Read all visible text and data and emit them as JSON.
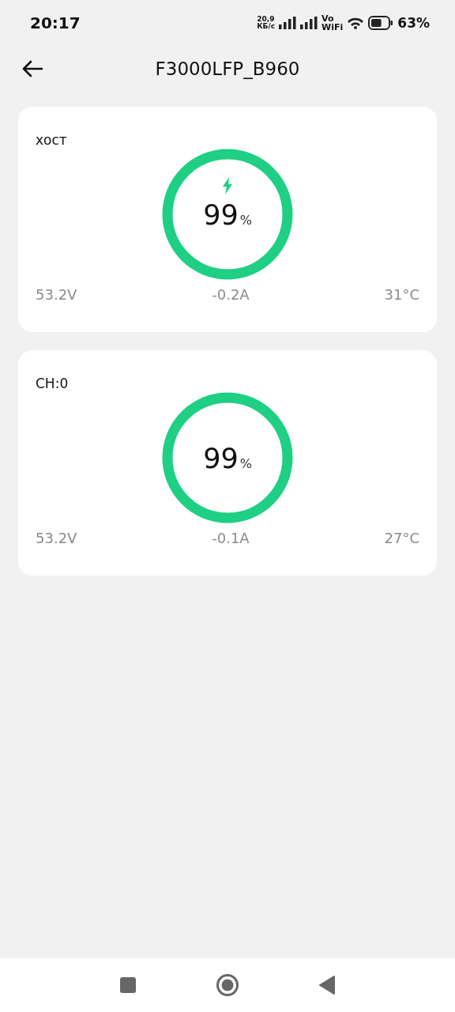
{
  "status_bar": {
    "time": "20:17",
    "net_speed": "20,9",
    "net_unit": "КБ/с",
    "volte": "Vo",
    "wifi_label": "WiFi",
    "battery": "63%"
  },
  "header": {
    "title": "F3000LFP_B960"
  },
  "packs": [
    {
      "name": "хост",
      "charging": true,
      "level": 0.99,
      "percent": "99",
      "unit": "%",
      "voltage": "53.2V",
      "current": "-0.2A",
      "temperature": "31°C"
    },
    {
      "name": "CH:0",
      "charging": false,
      "level": 0.99,
      "percent": "99",
      "unit": "%",
      "voltage": "53.2V",
      "current": "-0.1A",
      "temperature": "27°C"
    }
  ]
}
